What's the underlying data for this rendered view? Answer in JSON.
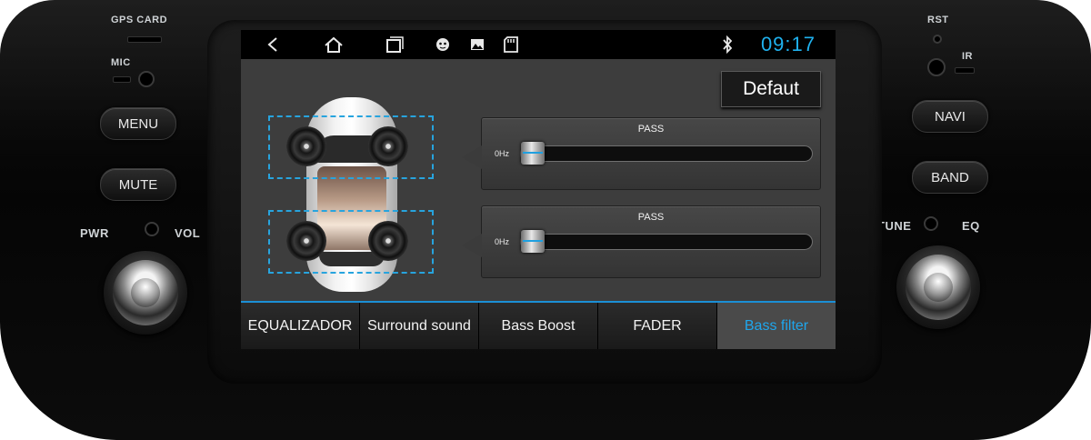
{
  "hardware": {
    "gps_label": "GPS CARD",
    "mic_label": "MIC",
    "menu_label": "MENU",
    "mute_label": "MUTE",
    "pwr_label": "PWR",
    "vol_label": "VOL",
    "rst_label": "RST",
    "ir_label": "IR",
    "navi_label": "NAVI",
    "band_label": "BAND",
    "tune_label": "TUNE",
    "eq_label": "EQ"
  },
  "statusbar": {
    "icons": [
      "back-icon",
      "home-icon",
      "recent-apps-icon",
      "android-icon",
      "image-icon",
      "sd-card-icon",
      "bluetooth-icon"
    ],
    "time": "09:17",
    "time_color": "#1fb1ee"
  },
  "main": {
    "default_button": "Defaut",
    "filters": [
      {
        "title": "PASS",
        "freq_label": "0Hz",
        "level": 0
      },
      {
        "title": "PASS",
        "freq_label": "0Hz",
        "level": 0
      }
    ]
  },
  "tabs": [
    {
      "label": "EQUALIZADOR",
      "active": false
    },
    {
      "label": "Surround sound",
      "active": false
    },
    {
      "label": "Bass Boost",
      "active": false
    },
    {
      "label": "FADER",
      "active": false
    },
    {
      "label": "Bass filter",
      "active": true
    }
  ],
  "colors": {
    "accent": "#1fa6ec",
    "speaker_zone_outline": "#27a4de"
  }
}
